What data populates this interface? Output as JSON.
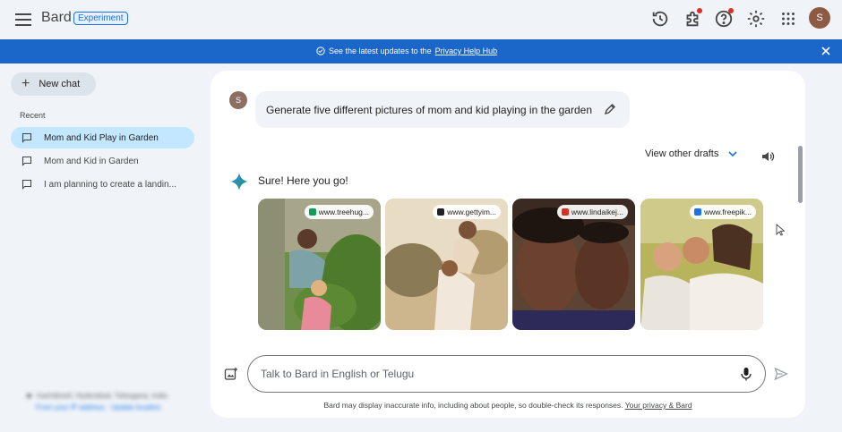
{
  "app": {
    "name": "Bard",
    "badge": "Experiment",
    "user_initial": "S"
  },
  "header_icons": [
    "history-icon",
    "extensions-icon",
    "help-icon",
    "settings-icon",
    "apps-grid-icon"
  ],
  "banner": {
    "text": "See the latest updates to the",
    "link": "Privacy Help Hub"
  },
  "sidebar": {
    "new_chat_label": "New chat",
    "recent_label": "Recent",
    "items": [
      {
        "label": "Mom and Kid Play in Garden",
        "active": true
      },
      {
        "label": "Mom and Kid in Garden",
        "active": false
      },
      {
        "label": "I am planning to create a landin...",
        "active": false
      }
    ],
    "location_line1": "Gachibowli, Hyderabad, Telangana, India",
    "location_line2": "From your IP address · Update location"
  },
  "conversation": {
    "user_initial": "S",
    "prompt": "Generate five different pictures of mom and kid playing in the garden",
    "view_drafts_label": "View other drafts",
    "response_text": "Sure! Here you go!",
    "images": [
      {
        "source": "www.treehug...",
        "favicon_color": "#0f9d58"
      },
      {
        "source": "www.gettyim...",
        "favicon_color": "#202124"
      },
      {
        "source": "www.lindaikej...",
        "favicon_color": "#d93025"
      },
      {
        "source": "www.freepik...",
        "favicon_color": "#1a73e8"
      }
    ]
  },
  "input": {
    "placeholder": "Talk to Bard in English or Telugu"
  },
  "disclaimer": {
    "text": "Bard may display inaccurate info, including about people, so double-check its responses.",
    "link": "Your privacy & Bard"
  },
  "colors": {
    "accent": "#1a73e8",
    "banner": "#1a66c9",
    "active_chat": "#c2e7ff",
    "background": "#f0f4f9"
  }
}
